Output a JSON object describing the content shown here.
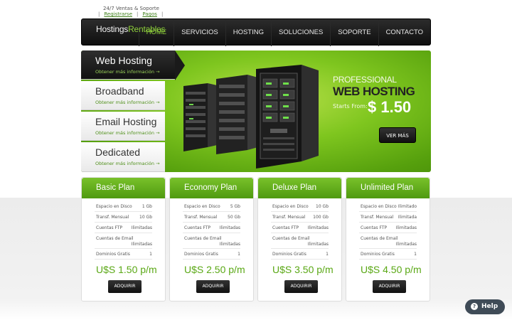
{
  "topbar": {
    "support": "24/7 Ventas & Soporte",
    "register": "Registrarse",
    "payments": "Pagos"
  },
  "nav": {
    "logo_part1": "Hostings",
    "logo_part2": "Rentables",
    "items": [
      "HOME",
      "SERVICIOS",
      "HOSTING",
      "SOLUCIONES",
      "SOPORTE",
      "CONTACTO"
    ],
    "active_index": 0
  },
  "hero": {
    "tabs": [
      {
        "title": "Web Hosting",
        "sub": "Obtener más información →"
      },
      {
        "title": "Broadband",
        "sub": "Obtener más información →"
      },
      {
        "title": "Email Hosting",
        "sub": "Obtener más información →"
      },
      {
        "title": "Dedicated",
        "sub": "Obtener más información →"
      }
    ],
    "line1": "PROFESSIONAL",
    "line2": "WEB HOSTING",
    "starts_from": "Starts From:",
    "price": "$ 1.50",
    "button": "VER MÁS"
  },
  "plans": [
    {
      "name": "Basic Plan",
      "disk_label": "Espacio en Disco",
      "disk": "1 Gb",
      "transfer_label": "Transf. Mensual",
      "transfer": "10 Gb",
      "ftp_label": "Cuentas FTP",
      "ftp": "Ilimitadas",
      "email_label": "Cuentas de Email",
      "email": "Ilimitadas",
      "domains_label": "Dominios Gratis",
      "domains": "1",
      "price": "U$S 1.50 p/m",
      "button": "ADQUIRIR"
    },
    {
      "name": "Economy Plan",
      "disk_label": "Espacio en Disco",
      "disk": "5 Gb",
      "transfer_label": "Transf. Mensual",
      "transfer": "50 Gb",
      "ftp_label": "Cuentas FTP",
      "ftp": "Ilimitadas",
      "email_label": "Cuentas de Email",
      "email": "Ilimitadas",
      "domains_label": "Dominios Gratis",
      "domains": "1",
      "price": "U$S 2.50 p/m",
      "button": "ADQUIRIR"
    },
    {
      "name": "Deluxe Plan",
      "disk_label": "Espacio en Disco",
      "disk": "10 Gb",
      "transfer_label": "Transf. Mensual",
      "transfer": "100 Gb",
      "ftp_label": "Cuentas FTP",
      "ftp": "Ilimitadas",
      "email_label": "Cuentas de Email",
      "email": "Ilimitadas",
      "domains_label": "Dominios Gratis",
      "domains": "1",
      "price": "U$S 3.50 p/m",
      "button": "ADQUIRIR"
    },
    {
      "name": "Unlimited Plan",
      "disk_label": "Espacio en Disco",
      "disk": "Ilimitado",
      "transfer_label": "Transf. Mensual",
      "transfer": "Ilimitada",
      "ftp_label": "Cuentas FTP",
      "ftp": "Ilimitadas",
      "email_label": "Cuentas de Email",
      "email": "Ilimitadas",
      "domains_label": "Dominios Gratis",
      "domains": "1",
      "price": "U$S 4.50 p/m",
      "button": "ADQUIRIR"
    }
  ],
  "help": {
    "icon": "question-icon",
    "label": "Help"
  },
  "colors": {
    "accent": "#5aa815",
    "nav_active": "#8fd13b",
    "dark": "#111111"
  }
}
